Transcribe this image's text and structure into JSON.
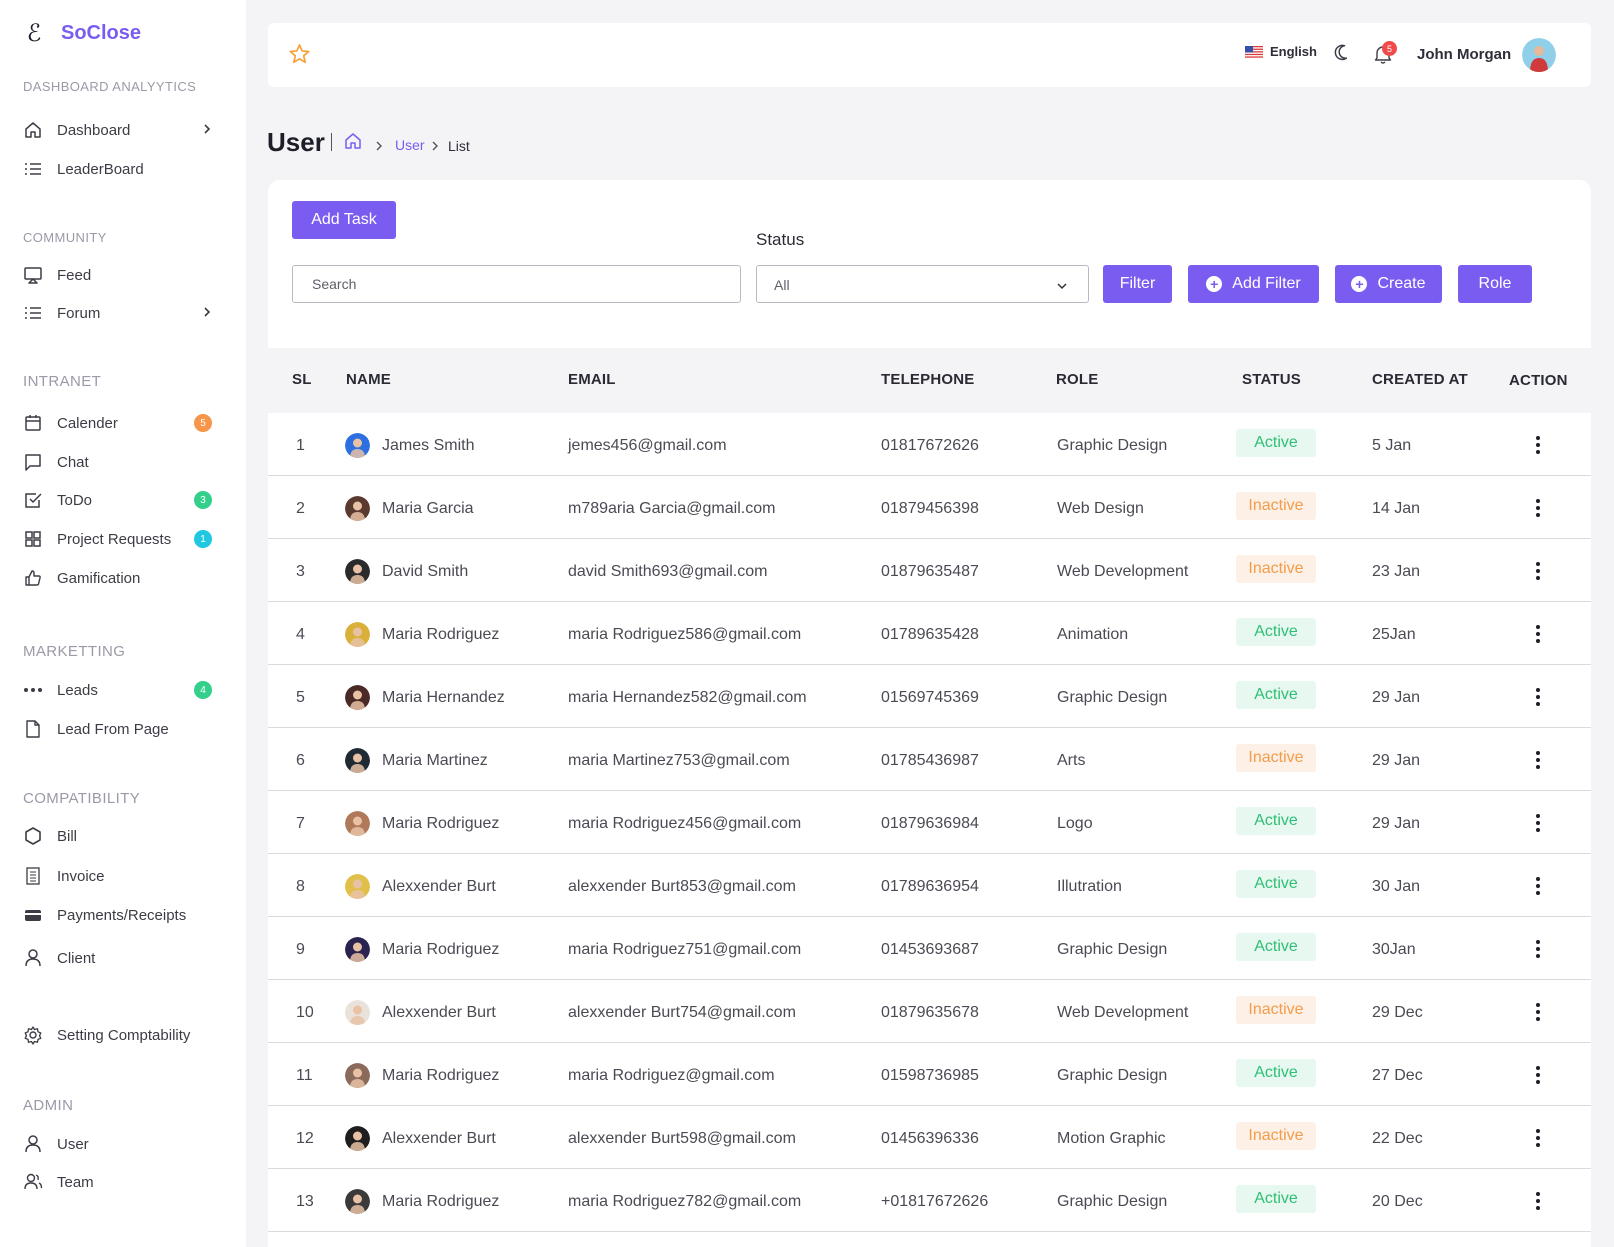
{
  "brand": {
    "logo_glyph": "ℰ",
    "name": "SoClose"
  },
  "sidebar": {
    "sections": [
      {
        "title": "DASHBOARD ANALYYTICS",
        "items": [
          {
            "label": "Dashboard",
            "icon": "home-icon",
            "chevron": true
          },
          {
            "label": "LeaderBoard",
            "icon": "list-icon"
          }
        ]
      },
      {
        "title": "COMMUNITY",
        "items": [
          {
            "label": "Feed",
            "icon": "screen-cast-icon"
          },
          {
            "label": "Forum",
            "icon": "list-icon",
            "chevron": true
          }
        ]
      },
      {
        "title": "INTRANET",
        "items": [
          {
            "label": "Calender",
            "icon": "calendar-icon",
            "badge": "5",
            "badge_color": "#f7954a"
          },
          {
            "label": "Chat",
            "icon": "chat-icon"
          },
          {
            "label": "ToDo",
            "icon": "checkbox-icon",
            "badge": "3",
            "badge_color": "#35cf8c"
          },
          {
            "label": "Project Requests",
            "icon": "grid-icon",
            "badge": "1",
            "badge_color": "#1fc8e0"
          },
          {
            "label": "Gamification",
            "icon": "thumbs-up-icon"
          }
        ]
      },
      {
        "title": "MARKETTING",
        "items": [
          {
            "label": "Leads",
            "icon": "dots-icon",
            "badge": "4",
            "badge_color": "#35cf8c"
          },
          {
            "label": "Lead From Page",
            "icon": "file-icon"
          }
        ]
      },
      {
        "title": "COMPATIBILITY",
        "items": [
          {
            "label": "Bill",
            "icon": "hexagon-icon"
          },
          {
            "label": "Invoice",
            "icon": "invoice-icon"
          },
          {
            "label": "Payments/Receipts",
            "icon": "card-icon"
          },
          {
            "label": "Client",
            "icon": "person-icon"
          },
          {
            "label": "Setting Comptability",
            "icon": "gear-icon"
          }
        ]
      },
      {
        "title": "ADMIN",
        "items": [
          {
            "label": "User",
            "icon": "person-icon"
          },
          {
            "label": "Team",
            "icon": "team-icon"
          }
        ]
      }
    ]
  },
  "topbar": {
    "language": "English",
    "notifications_count": "5",
    "user_name": "John Morgan"
  },
  "page": {
    "title": "User",
    "breadcrumb": {
      "middle": "User",
      "current": "List"
    }
  },
  "toolbar": {
    "add_task": "Add Task",
    "status_label": "Status",
    "search_placeholder": "Search",
    "status_value": "All",
    "filter": "Filter",
    "add_filter": "Add Filter",
    "create": "Create",
    "role": "Role"
  },
  "table": {
    "columns": {
      "sl": "SL",
      "name": "NAME",
      "email": "EMAIL",
      "telephone": "TELEPHONE",
      "role": "ROLE",
      "status": "STATUS",
      "created_at": "CREATED AT",
      "action": "ACTION"
    },
    "rows": [
      {
        "sl": "1",
        "name": "James Smith",
        "email": "jemes456@gmail.com",
        "telephone": "01817672626",
        "role": "Graphic Design",
        "status": "Active",
        "created_at": "5 Jan",
        "avatar_color": "#2d6fe0"
      },
      {
        "sl": "2",
        "name": "Maria Garcia",
        "email": "m789aria Garcia@gmail.com",
        "telephone": "01879456398",
        "role": "Web Design",
        "status": "Inactive",
        "created_at": "14 Jan",
        "avatar_color": "#5a3a2e"
      },
      {
        "sl": "3",
        "name": "David Smith",
        "email": "david Smith693@gmail.com",
        "telephone": "01879635487",
        "role": "Web Development",
        "status": "Inactive",
        "created_at": "23 Jan",
        "avatar_color": "#2b2b2b"
      },
      {
        "sl": "4",
        "name": "Maria Rodriguez",
        "email": "maria Rodriguez586@gmail.com",
        "telephone": "01789635428",
        "role": "Animation",
        "status": "Active",
        "created_at": "25Jan",
        "avatar_color": "#d9b13a"
      },
      {
        "sl": "5",
        "name": "Maria Hernandez",
        "email": "maria Hernandez582@gmail.com",
        "telephone": "01569745369",
        "role": "Graphic Design",
        "status": "Active",
        "created_at": "29 Jan",
        "avatar_color": "#4a2a26"
      },
      {
        "sl": "6",
        "name": "Maria Martinez",
        "email": "maria Martinez753@gmail.com",
        "telephone": "01785436987",
        "role": "Arts",
        "status": "Inactive",
        "created_at": "29 Jan",
        "avatar_color": "#1f2a35"
      },
      {
        "sl": "7",
        "name": "Maria Rodriguez",
        "email": "maria Rodriguez456@gmail.com",
        "telephone": "01879636984",
        "role": "Logo",
        "status": "Active",
        "created_at": "29 Jan",
        "avatar_color": "#b07a5a"
      },
      {
        "sl": "8",
        "name": "Alexxender Burt",
        "email": "alexxender Burt853@gmail.com",
        "telephone": "01789636954",
        "role": "Illutration",
        "status": "Active",
        "created_at": "30 Jan",
        "avatar_color": "#e0c04a"
      },
      {
        "sl": "9",
        "name": "Maria Rodriguez",
        "email": "maria Rodriguez751@gmail.com",
        "telephone": "01453693687",
        "role": "Graphic Design",
        "status": "Active",
        "created_at": "30Jan",
        "avatar_color": "#2a2350"
      },
      {
        "sl": "10",
        "name": "Alexxender Burt",
        "email": "alexxender Burt754@gmail.com",
        "telephone": "01879635678",
        "role": "Web Development",
        "status": "Inactive",
        "created_at": "29 Dec",
        "avatar_color": "#e8e2da"
      },
      {
        "sl": "11",
        "name": "Maria Rodriguez",
        "email": "maria Rodriguez@gmail.com",
        "telephone": "01598736985",
        "role": "Graphic Design",
        "status": "Active",
        "created_at": "27 Dec",
        "avatar_color": "#8a6a5a"
      },
      {
        "sl": "12",
        "name": "Alexxender Burt",
        "email": "alexxender Burt598@gmail.com",
        "telephone": "01456396336",
        "role": "Motion Graphic",
        "status": "Inactive",
        "created_at": "22 Dec",
        "avatar_color": "#1e1e1e"
      },
      {
        "sl": "13",
        "name": "Maria Rodriguez",
        "email": "maria Rodriguez782@gmail.com",
        "telephone": "+01817672626",
        "role": "Graphic Design",
        "status": "Active",
        "created_at": "20 Dec",
        "avatar_color": "#3a3a3a"
      }
    ]
  },
  "colors": {
    "accent": "#7b5cf0",
    "active_text": "#2fbf76",
    "inactive_text": "#f39c4a"
  }
}
